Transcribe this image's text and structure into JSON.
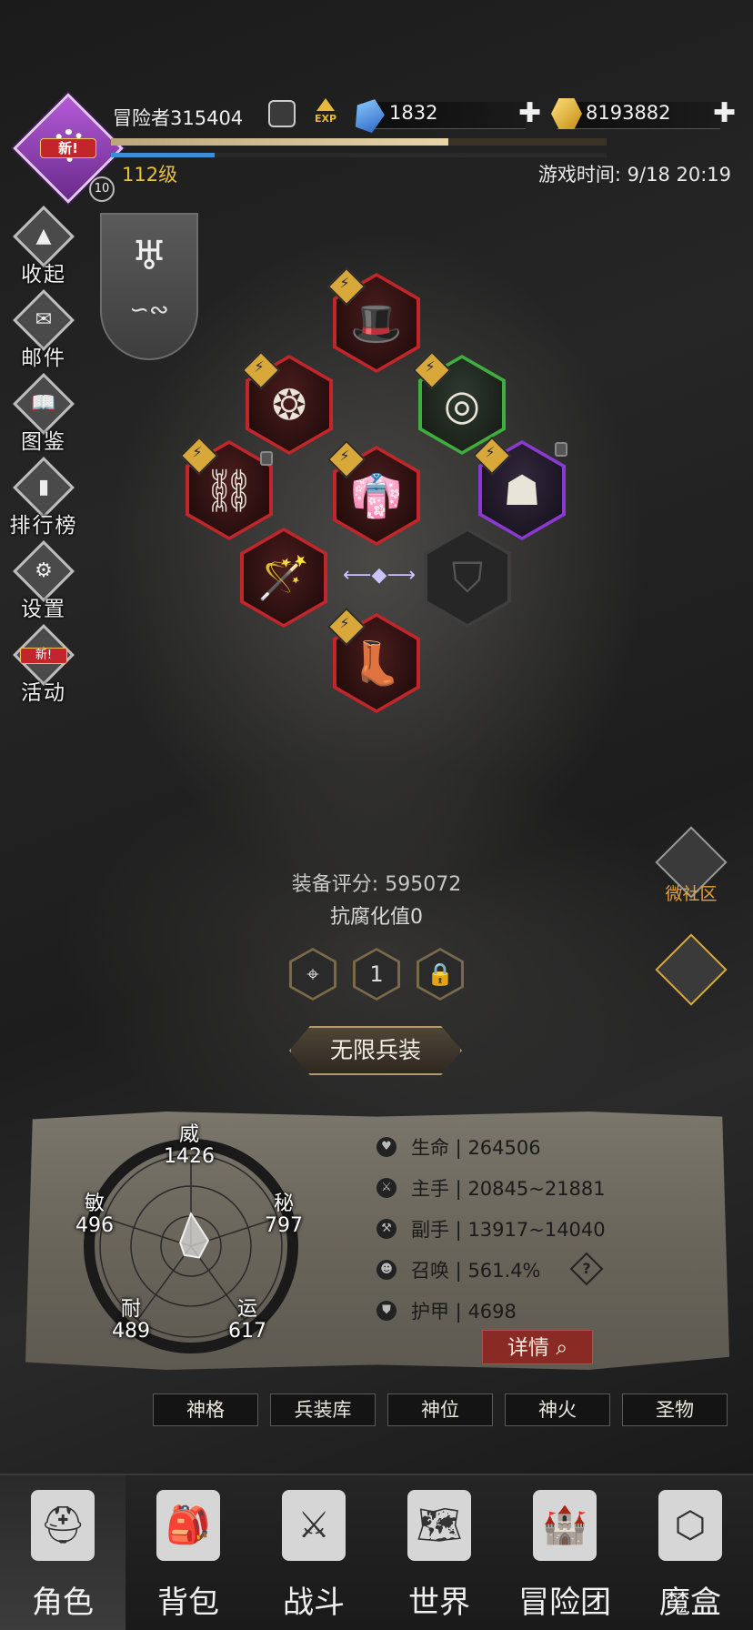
{
  "header": {
    "player_name": "冒险者315404",
    "avatar_badge": "新!",
    "avatar_level_badge": "10",
    "exp_label": "EXP",
    "diamonds": "1832",
    "gold": "8193882",
    "level_text": "112级",
    "game_time": "游戏时间: 9/18 20:19",
    "exp_progress": 0.68,
    "mana_progress": 0.21
  },
  "side_menu": [
    {
      "label": "收起",
      "icon": "collapse-icon"
    },
    {
      "label": "邮件",
      "icon": "mail-icon"
    },
    {
      "label": "图鉴",
      "icon": "book-icon"
    },
    {
      "label": "排行榜",
      "icon": "ranking-icon"
    },
    {
      "label": "设置",
      "icon": "gear-icon"
    },
    {
      "label": "活动",
      "icon": "event-icon",
      "badge": "新!"
    }
  ],
  "equipment": {
    "score_label": "装备评分: 595072",
    "anti_corrosion": "抗腐化值0",
    "mini_buttons": [
      "",
      "1",
      ""
    ],
    "infinite_button": "无限兵装"
  },
  "right_buttons": {
    "community": "微社区"
  },
  "attributes": {
    "wei": {
      "name": "威",
      "value": "1426"
    },
    "mi": {
      "name": "秘",
      "value": "797"
    },
    "yun": {
      "name": "运",
      "value": "617"
    },
    "nai": {
      "name": "耐",
      "value": "489"
    },
    "min": {
      "name": "敏",
      "value": "496"
    }
  },
  "stats": [
    {
      "label": "生命",
      "value": "264506",
      "icon": "heart-icon"
    },
    {
      "label": "主手",
      "value": "20845~21881",
      "icon": "sword-icon"
    },
    {
      "label": "副手",
      "value": "13917~14040",
      "icon": "offhand-icon"
    },
    {
      "label": "召唤",
      "value": "561.4%",
      "icon": "summon-icon"
    },
    {
      "label": "护甲",
      "value": "4698",
      "icon": "armor-icon"
    }
  ],
  "detail_button": "详情",
  "sub_tabs": [
    "神格",
    "兵装库",
    "神位",
    "神火",
    "圣物"
  ],
  "bottom_nav": [
    {
      "label": "角色",
      "icon": "helmet-icon",
      "active": true
    },
    {
      "label": "背包",
      "icon": "backpack-icon"
    },
    {
      "label": "战斗",
      "icon": "shield-sword-icon"
    },
    {
      "label": "世界",
      "icon": "map-icon"
    },
    {
      "label": "冒险团",
      "icon": "castle-icon"
    },
    {
      "label": "魔盒",
      "icon": "cube-icon"
    }
  ],
  "colors": {
    "rarity_red": "#c0262a",
    "rarity_green": "#3fae3f",
    "rarity_purple": "#8a3ad0",
    "level_gold": "#e6c13e",
    "accent_orange": "#e8a23a"
  }
}
